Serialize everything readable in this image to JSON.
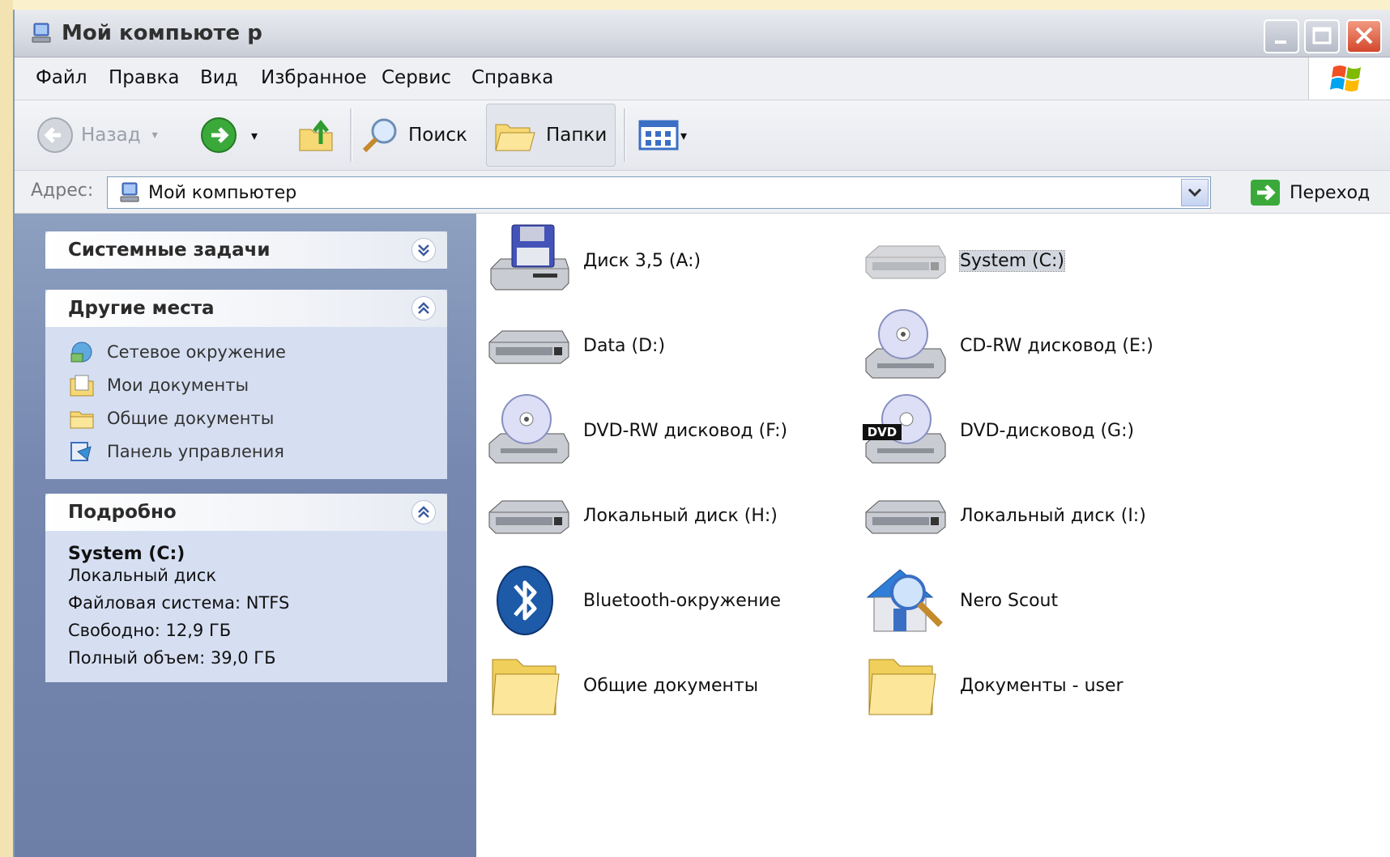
{
  "window": {
    "title": "Мой компьюте р"
  },
  "menubar": {
    "items": [
      "Файл",
      "Правка",
      "Вид",
      "Избранное",
      "Сервис",
      "Справка"
    ]
  },
  "toolbar": {
    "back": "Назад",
    "search": "Поиск",
    "folders": "Папки"
  },
  "addressbar": {
    "label": "Адрес:",
    "value": "Мой компьютер",
    "go": "Переход"
  },
  "sidebar": {
    "system_tasks": {
      "title": "Системные задачи"
    },
    "other_places": {
      "title": "Другие места",
      "items": [
        "Сетевое окружение",
        "Мои документы",
        "Общие документы",
        "Панель управления"
      ]
    },
    "details": {
      "title": "Подробно",
      "name": "System (C:)",
      "type": "Локальный диск",
      "fs": "Файловая система: NTFS",
      "free": "Свободно: 12,9 ГБ",
      "total": "Полный объем: 39,0 ГБ"
    }
  },
  "items": [
    {
      "label": "Диск 3,5 (A:)",
      "icon": "floppy-drive-icon"
    },
    {
      "label": "System (C:)",
      "icon": "hard-drive-icon",
      "selected": true
    },
    {
      "label": "Data (D:)",
      "icon": "hard-drive-icon"
    },
    {
      "label": "CD-RW дисковод (E:)",
      "icon": "cd-drive-icon"
    },
    {
      "label": "DVD-RW дисковод (F:)",
      "icon": "cd-drive-icon"
    },
    {
      "label": "DVD-дисковод (G:)",
      "icon": "dvd-drive-icon"
    },
    {
      "label": "Локальный диск (H:)",
      "icon": "hard-drive-icon"
    },
    {
      "label": "Локальный диск (I:)",
      "icon": "hard-drive-icon"
    },
    {
      "label": "Bluetooth-окружение",
      "icon": "bluetooth-icon"
    },
    {
      "label": "Nero Scout",
      "icon": "nero-scout-icon"
    },
    {
      "label": "Общие документы",
      "icon": "folder-icon"
    },
    {
      "label": "Документы - user",
      "icon": "folder-icon"
    }
  ]
}
